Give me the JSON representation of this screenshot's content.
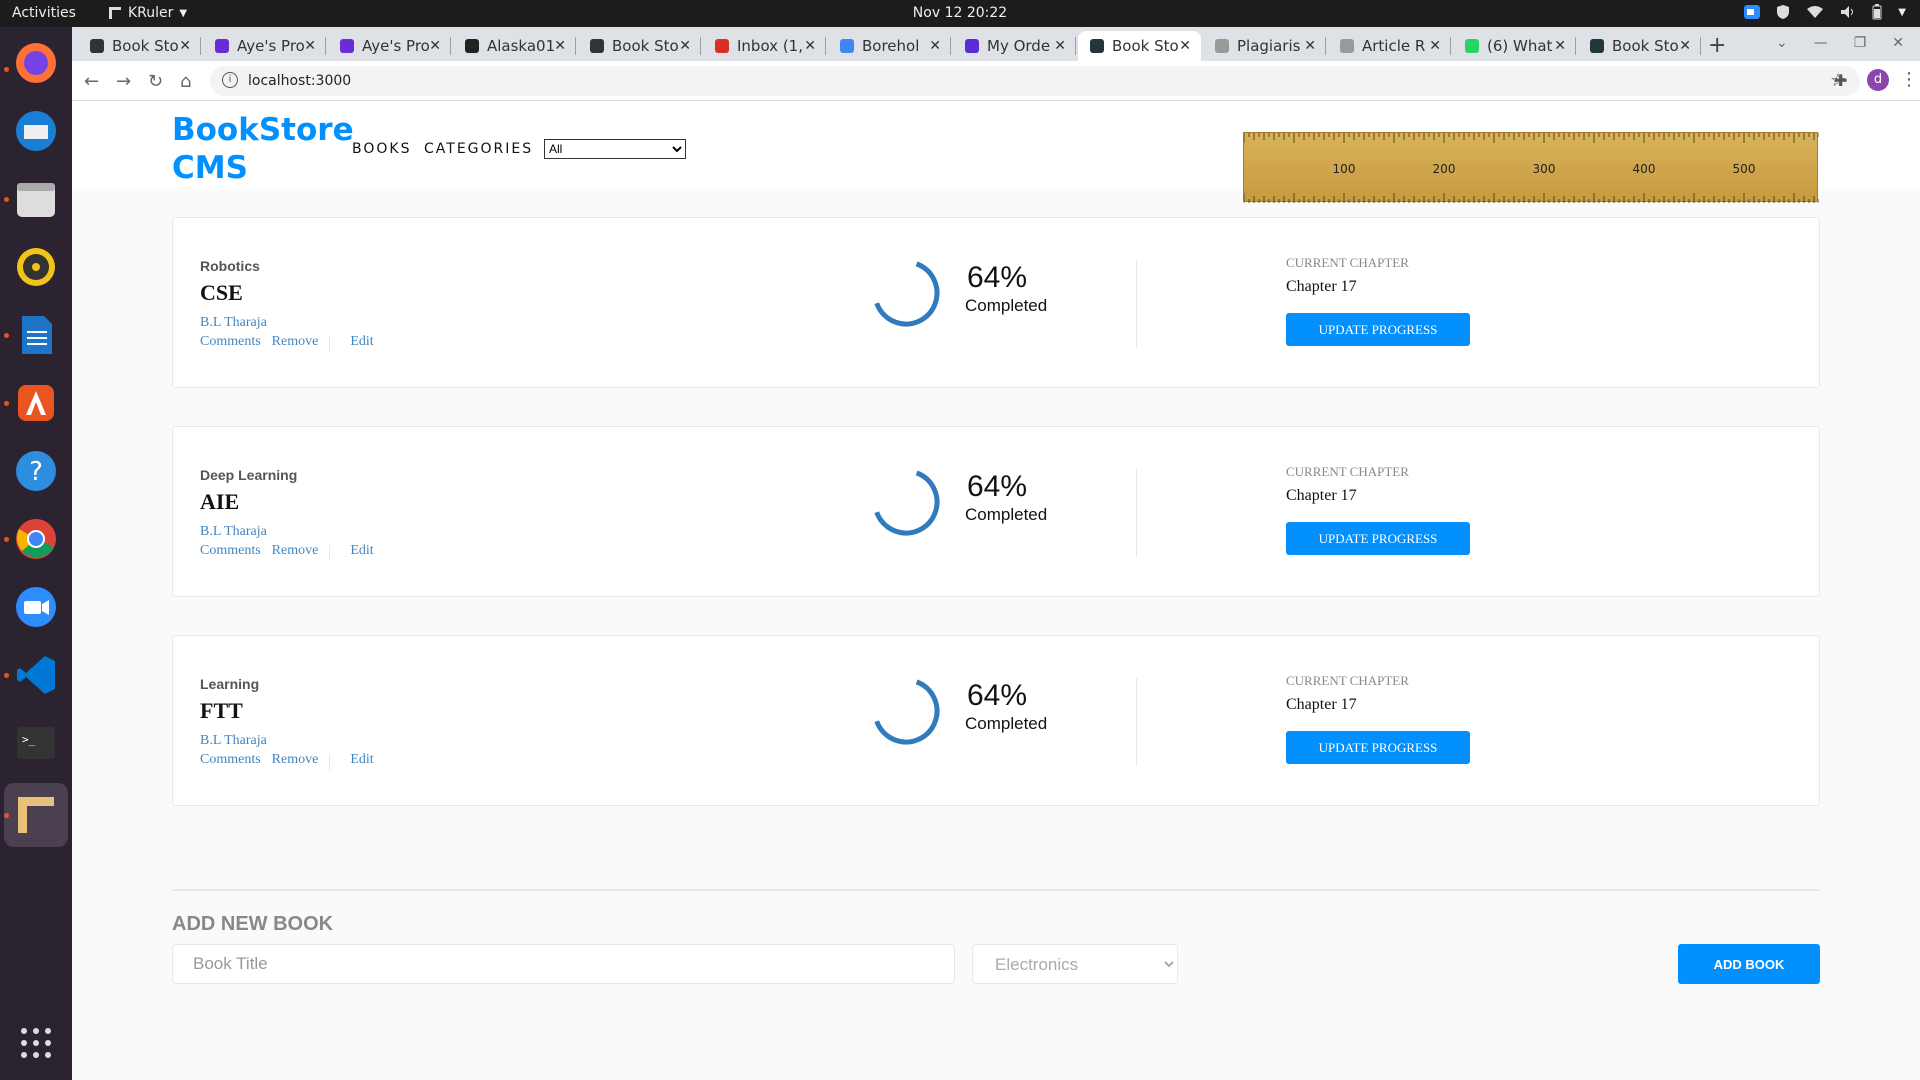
{
  "topbar": {
    "activities": "Activities",
    "app_name": "KRuler",
    "clock": "Nov 12  20:22"
  },
  "tabs": [
    {
      "label": "Book Sto",
      "color": "#333333",
      "active": false
    },
    {
      "label": "Aye's Pro",
      "color": "#6b2bd6",
      "active": false
    },
    {
      "label": "Aye's Pro",
      "color": "#6b2bd6",
      "active": false
    },
    {
      "label": "Alaska01",
      "color": "#222222",
      "active": false
    },
    {
      "label": "Book Sto",
      "color": "#333333",
      "active": false
    },
    {
      "label": "Inbox (1,",
      "color": "#d93025",
      "active": false
    },
    {
      "label": "Borehol",
      "color": "#4285f4",
      "active": false
    },
    {
      "label": "My Orde",
      "color": "#5b2bd6",
      "active": false
    },
    {
      "label": "Book Sto",
      "color": "#23373b",
      "active": true
    },
    {
      "label": "Plagiaris",
      "color": "#999999",
      "active": false
    },
    {
      "label": "Article R",
      "color": "#999999",
      "active": false
    },
    {
      "label": "(6) What",
      "color": "#25d366",
      "active": false
    },
    {
      "label": "Book Sto",
      "color": "#23373b",
      "active": false
    }
  ],
  "omnibox": {
    "url": "localhost:3000"
  },
  "profile_initial": "d",
  "header": {
    "logo": "BookStore CMS",
    "nav_books": "BOOKS",
    "nav_categories": "CATEGORIES",
    "filter_selected": "All",
    "accent_color": "#0290ff"
  },
  "ruler": {
    "labels": [
      "100",
      "200",
      "300",
      "400",
      "500"
    ]
  },
  "books": [
    {
      "genre": "Robotics",
      "title": "CSE",
      "author": "B.L Tharaja",
      "progress": "64%",
      "completed_label": "Completed",
      "chapter_label": "CURRENT CHAPTER",
      "chapter": "Chapter 17",
      "update_label": "UPDATE PROGRESS",
      "actions": [
        "Comments",
        "Remove",
        "Edit"
      ]
    },
    {
      "genre": "Deep Learning",
      "title": "AIE",
      "author": "B.L Tharaja",
      "progress": "64%",
      "completed_label": "Completed",
      "chapter_label": "CURRENT CHAPTER",
      "chapter": "Chapter 17",
      "update_label": "UPDATE PROGRESS",
      "actions": [
        "Comments",
        "Remove",
        "Edit"
      ]
    },
    {
      "genre": "Learning",
      "title": "FTT",
      "author": "B.L Tharaja",
      "progress": "64%",
      "completed_label": "Completed",
      "chapter_label": "CURRENT CHAPTER",
      "chapter": "Chapter 17",
      "update_label": "UPDATE PROGRESS",
      "actions": [
        "Comments",
        "Remove",
        "Edit"
      ]
    }
  ],
  "add_book": {
    "heading": "ADD NEW BOOK",
    "title_placeholder": "Book Title",
    "category_selected": "Electronics",
    "button_label": "ADD BOOK"
  }
}
